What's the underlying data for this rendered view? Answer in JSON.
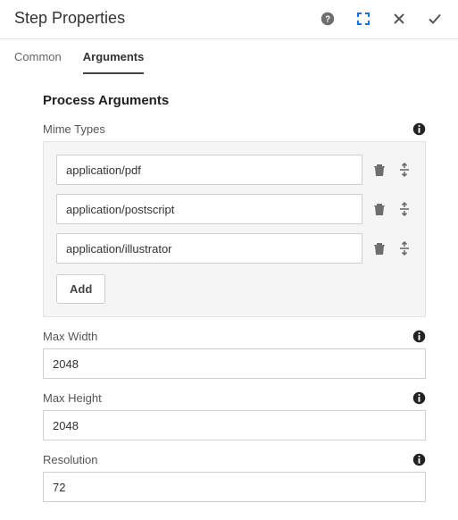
{
  "header": {
    "title": "Step Properties"
  },
  "tabs": {
    "common": "Common",
    "arguments": "Arguments"
  },
  "section": {
    "title": "Process Arguments",
    "mimeLabel": "Mime Types",
    "mimeTypes": [
      "application/pdf",
      "application/postscript",
      "application/illustrator"
    ],
    "addLabel": "Add",
    "maxWidth": {
      "label": "Max Width",
      "value": "2048"
    },
    "maxHeight": {
      "label": "Max Height",
      "value": "2048"
    },
    "resolution": {
      "label": "Resolution",
      "value": "72"
    }
  }
}
